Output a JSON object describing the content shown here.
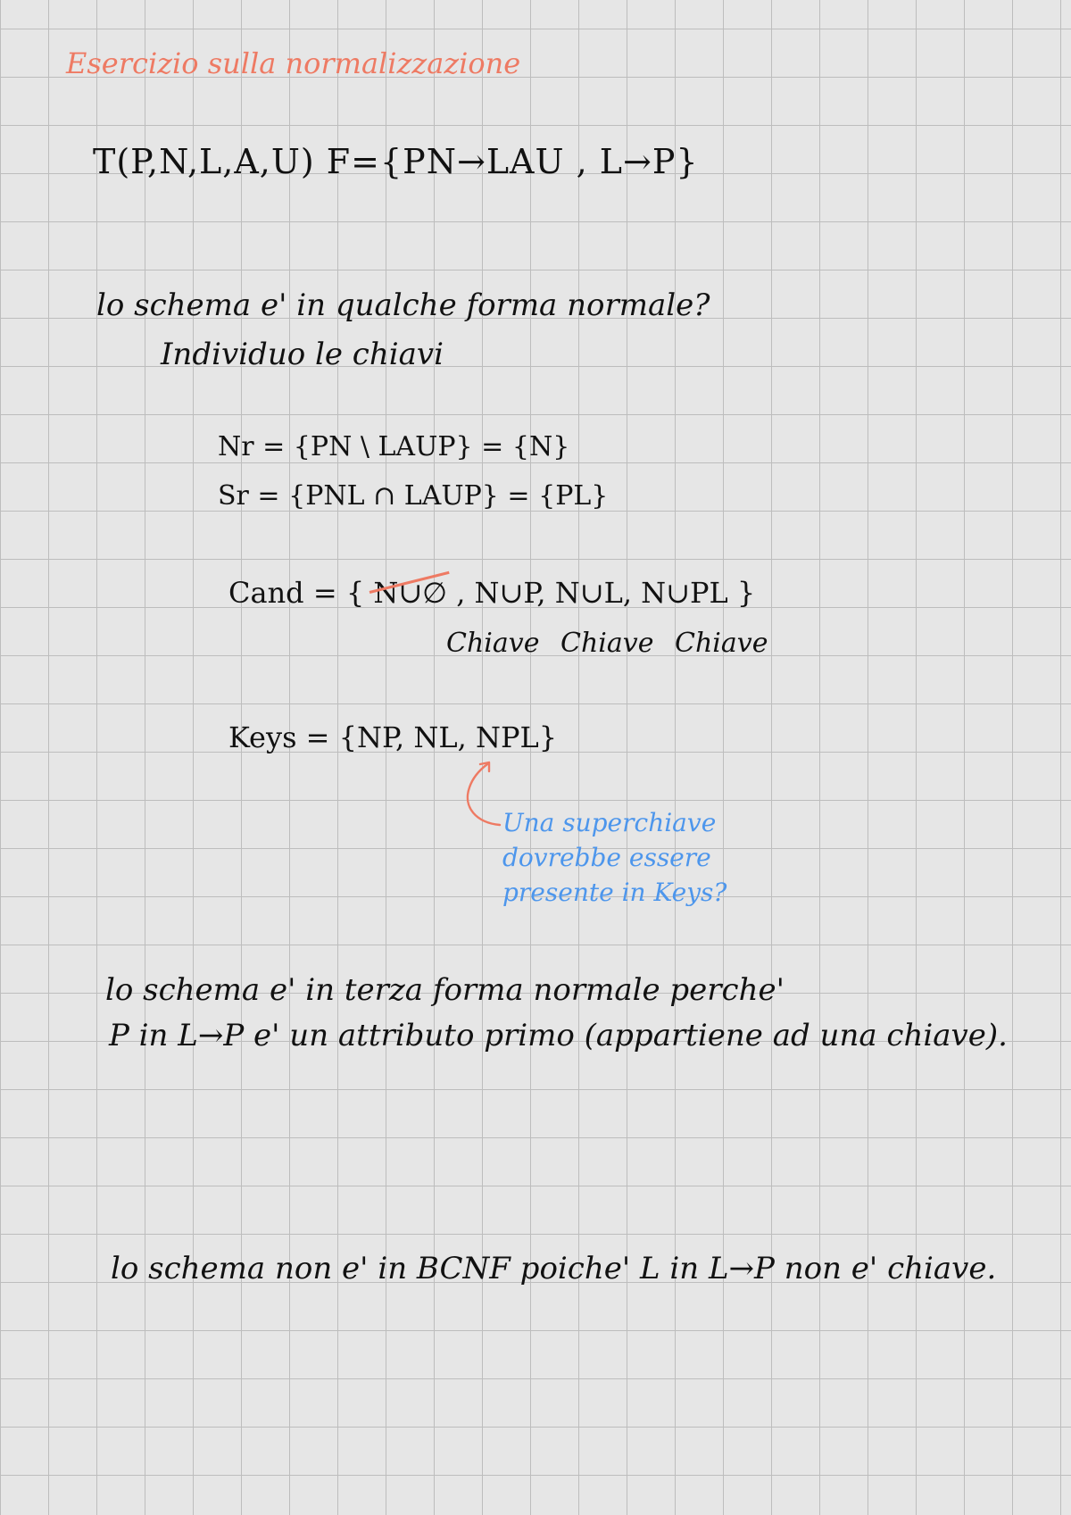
{
  "page": {
    "title": "Esercizio sulla normalizzazione",
    "schema_formula": "T(P,N,L,A,U)  F={PN→LAU , L→P}",
    "question": "lo schema e' in qualche forma normale?",
    "step": "Individuo le chiavi",
    "lr": "Nr = {PN \\ LAUP} = {N}",
    "sr": "Sr = {PNL ∩ LAUP} = {PL}",
    "cand_prefix": "Cand = {",
    "cand_struck": "N∪∅",
    "cand_rest": ", N∪P, N∪L, N∪PL }",
    "chiave_labels": [
      "Chiave",
      "Chiave",
      "Chiave"
    ],
    "keys": "Keys = {NP, NL, NPL}",
    "note_lines": [
      "Una superchiave",
      "dovrebbe essere",
      "presente in Keys?"
    ],
    "third_nf_line1": "lo schema e' in terza forma normale perche'",
    "third_nf_line2": "P in L→P e' un attributo primo (appartiene ad una chiave).",
    "bcnf": "lo schema non e' in BCNF poiche' L in L→P non e' chiave."
  },
  "colors": {
    "title": "#ee7a63",
    "ink": "#111111",
    "note": "#4d96ec",
    "grid": "#bdbdbd",
    "background": "#e6e6e6"
  }
}
